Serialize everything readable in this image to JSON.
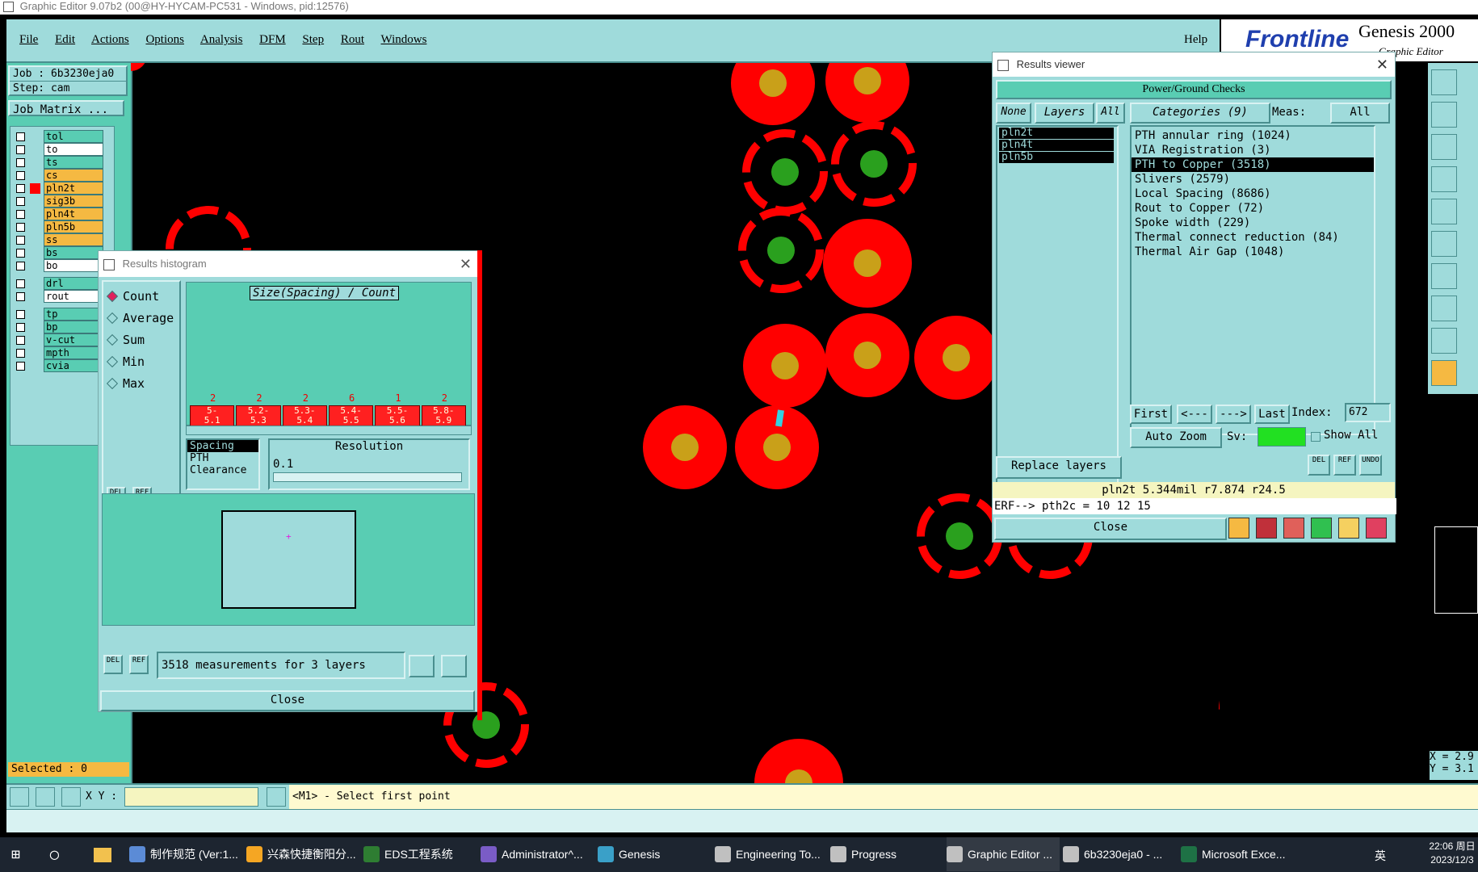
{
  "window_title": "Graphic Editor 9.07b2 (00@HY-HYCAM-PC531 - Windows, pid:12576)",
  "menu": [
    "File",
    "Edit",
    "Actions",
    "Options",
    "Analysis",
    "DFM",
    "Step",
    "Rout",
    "Windows"
  ],
  "help_label": "Help",
  "brand": {
    "logo": "Frontline",
    "product": "Genesis 2000",
    "sub": "Graphic Editor"
  },
  "job": {
    "job_label": "Job : 6b3230eja0",
    "step_label": "Step: cam",
    "matrix_button": "Job Matrix ..."
  },
  "layers": [
    {
      "name": "tol",
      "color": "#59cdb3"
    },
    {
      "name": "to",
      "color": "#ffffff"
    },
    {
      "name": "ts",
      "color": "#59cdb3"
    },
    {
      "name": "cs",
      "color": "#f5b942"
    },
    {
      "name": "pln2t",
      "color": "#f5b942",
      "active": true
    },
    {
      "name": "sig3b",
      "color": "#f5b942"
    },
    {
      "name": "pln4t",
      "color": "#f5b942"
    },
    {
      "name": "pln5b",
      "color": "#f5b942"
    },
    {
      "name": "ss",
      "color": "#f5b942"
    },
    {
      "name": "bs",
      "color": "#59cdb3"
    },
    {
      "name": "bo",
      "color": "#ffffff"
    }
  ],
  "layers2": [
    {
      "name": "drl",
      "color": "#59cdb3"
    },
    {
      "name": "rout",
      "color": "#ffffff"
    }
  ],
  "layers3": [
    {
      "name": "tp",
      "color": "#59cdb3"
    },
    {
      "name": "bp",
      "color": "#59cdb3"
    },
    {
      "name": "v-cut",
      "color": "#59cdb3"
    },
    {
      "name": "mpth",
      "color": "#59cdb3"
    },
    {
      "name": "cvia",
      "color": "#59cdb3"
    }
  ],
  "selected_label": "Selected : 0",
  "histogram": {
    "title": "Results histogram",
    "modes": [
      "Count",
      "Average",
      "Sum",
      "Min",
      "Max"
    ],
    "selected_mode": "Count",
    "chart_title": "Size(Spacing) / Count",
    "bins": [
      {
        "count": "2",
        "range": "5-\n5.1"
      },
      {
        "count": "2",
        "range": "5.2-\n5.3"
      },
      {
        "count": "2",
        "range": "5.3-\n5.4"
      },
      {
        "count": "6",
        "range": "5.4-\n5.5"
      },
      {
        "count": "1",
        "range": "5.5-\n5.6"
      },
      {
        "count": "2",
        "range": "5.8-\n5.9"
      }
    ],
    "types": [
      "Spacing",
      "PTH",
      "Clearance"
    ],
    "resolution_label": "Resolution",
    "resolution_value": "0.1",
    "measurements": "3518 measurements for 3 layers",
    "close": "Close",
    "del": "DEL",
    "ref": "REF"
  },
  "results": {
    "title": "Results viewer",
    "header": "Power/Ground Checks",
    "none_btn": "None",
    "layers_btn": "Layers",
    "all_btn": "All",
    "layers": [
      "pln2t",
      "pln4t",
      "pln5b"
    ],
    "categories_btn": "Categories (9)",
    "meas_label": "Meas:",
    "meas_value": "All",
    "categories": [
      "PTH annular ring (1024)",
      "VIA Registration (3)",
      "PTH to Copper (3518)",
      "Slivers (2579)",
      "Local Spacing (8686)",
      "Rout to Copper (72)",
      "Spoke width (229)",
      "Thermal connect reduction (84)",
      "Thermal Air Gap (1048)"
    ],
    "selected_category": "PTH to Copper (3518)",
    "first": "First",
    "prev": "<---",
    "next": "--->",
    "last": "Last",
    "index_label": "Index:",
    "index_value": "672",
    "auto_zoom": "Auto Zoom",
    "sv_label": "Sv:",
    "show_all": "Show All",
    "replace_layers": "Replace layers",
    "status": "pln2t 5.344mil   r7.874   r24.5",
    "erf": "ERF--> pth2c = 10 12 15",
    "close": "Close",
    "del": "DEL",
    "ref": "REF",
    "undo": "UNDO"
  },
  "statusbar": {
    "xy_label": "X Y :",
    "prompt": "<M1> - Select first point"
  },
  "coords": {
    "x": "X = 2.9",
    "y": "Y = 3.1"
  },
  "taskbar": {
    "items": [
      "制作规范 (Ver:1...",
      "兴森快捷衡阳分...",
      "EDS工程系统",
      "Administrator^...",
      "Genesis",
      "Engineering To...",
      "Progress",
      "Graphic Editor ...",
      "6b3230eja0 - ...",
      "Microsoft Exce..."
    ],
    "active": "Graphic Editor ...",
    "time": "22:06 周日",
    "date": "2023/12/3",
    "ime": "英"
  },
  "colors": {
    "teal": "#59cdb3",
    "light_teal": "#9fdbdb",
    "pad_red": "#ff0000",
    "pad_center": "#c9a019",
    "via_green": "#2aa01e"
  }
}
